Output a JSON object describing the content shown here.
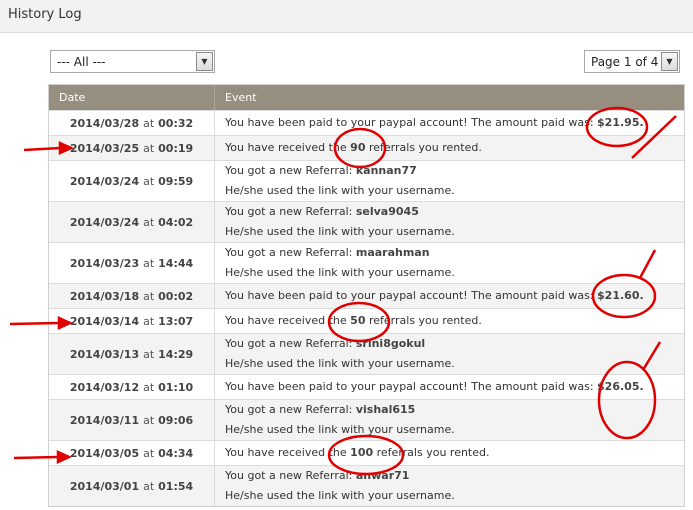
{
  "header": {
    "title": "History Log"
  },
  "filter": {
    "selected": "--- All ---"
  },
  "pager": {
    "selected": "Page 1 of 4"
  },
  "table": {
    "columns": [
      "Date",
      "Event"
    ],
    "rows": [
      {
        "date": "2014/03/28",
        "at": "at",
        "time": "00:32",
        "lines": [
          [
            "You have been paid to your paypal account! The amount paid was: ",
            "$21.95."
          ]
        ]
      },
      {
        "date": "2014/03/25",
        "at": "at",
        "time": "00:19",
        "lines": [
          [
            "You have received the ",
            "90",
            " referrals you rented."
          ]
        ]
      },
      {
        "date": "2014/03/24",
        "at": "at",
        "time": "09:59",
        "lines": [
          [
            "You got a new Referral: ",
            "kannan77"
          ],
          [
            "He/she used the link with your username."
          ]
        ]
      },
      {
        "date": "2014/03/24",
        "at": "at",
        "time": "04:02",
        "lines": [
          [
            "You got a new Referral: ",
            "selva9045"
          ],
          [
            "He/she used the link with your username."
          ]
        ]
      },
      {
        "date": "2014/03/23",
        "at": "at",
        "time": "14:44",
        "lines": [
          [
            "You got a new Referral: ",
            "maarahman"
          ],
          [
            "He/she used the link with your username."
          ]
        ]
      },
      {
        "date": "2014/03/18",
        "at": "at",
        "time": "00:02",
        "lines": [
          [
            "You have been paid to your paypal account! The amount paid was: ",
            "$21.60."
          ]
        ]
      },
      {
        "date": "2014/03/14",
        "at": "at",
        "time": "13:07",
        "lines": [
          [
            "You have received the ",
            "50",
            " referrals you rented."
          ]
        ]
      },
      {
        "date": "2014/03/13",
        "at": "at",
        "time": "14:29",
        "lines": [
          [
            "You got a new Referral: ",
            "srini8gokul"
          ],
          [
            "He/she used the link with your username."
          ]
        ]
      },
      {
        "date": "2014/03/12",
        "at": "at",
        "time": "01:10",
        "lines": [
          [
            "You have been paid to your paypal account! The amount paid was: ",
            "$26.05."
          ]
        ]
      },
      {
        "date": "2014/03/11",
        "at": "at",
        "time": "09:06",
        "lines": [
          [
            "You got a new Referral: ",
            "vishal615"
          ],
          [
            "He/she used the link with your username."
          ]
        ]
      },
      {
        "date": "2014/03/05",
        "at": "at",
        "time": "04:34",
        "lines": [
          [
            "You have received the ",
            "100",
            " referrals you rented."
          ]
        ]
      },
      {
        "date": "2014/03/01",
        "at": "at",
        "time": "01:54",
        "lines": [
          [
            "You got a new Referral: ",
            "anwar71"
          ],
          [
            "He/she used the link with your username."
          ]
        ]
      }
    ]
  },
  "colors": {
    "header_bar": "#f2f2f2",
    "table_head": "#968e7f",
    "row_alt": "#f3f3f3",
    "annotation": "#e00000"
  },
  "icons": {
    "dropdown": "chevron-down-icon",
    "annotation_arrow": "red-arrow-icon",
    "annotation_circle": "red-circle-icon"
  }
}
